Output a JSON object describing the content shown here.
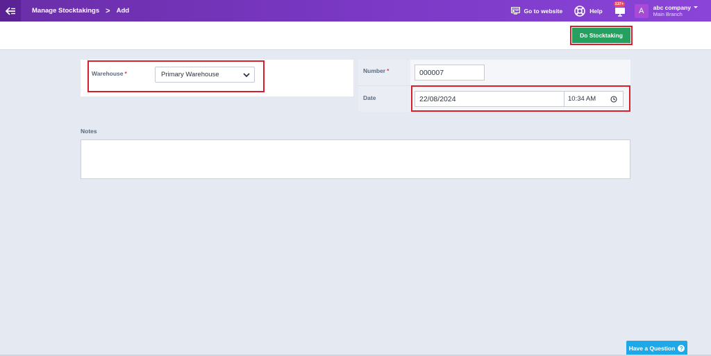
{
  "topbar": {
    "breadcrumb_parent": "Manage Stocktakings",
    "breadcrumb_sep": ">",
    "breadcrumb_current": "Add",
    "go_to_website": "Go to website",
    "help": "Help",
    "notification_count": "137+",
    "avatar_letter": "A",
    "account_name": "abc company",
    "account_branch": "Main Branch"
  },
  "actions": {
    "do_stocktaking": "Do Stocktaking"
  },
  "form": {
    "warehouse_label": "Warehouse",
    "required_mark": "*",
    "warehouse_value": "Primary Warehouse",
    "number_label": "Number",
    "number_value": "000007",
    "date_label": "Date",
    "date_value": "22/08/2024",
    "time_value": "10:34 AM",
    "notes_label": "Notes"
  },
  "help_widget": {
    "label": "Have a Question",
    "q_icon": "?"
  },
  "colors": {
    "topbar_start": "#6a2ea8",
    "topbar_end": "#8a45d8",
    "primary_action": "#25a05e",
    "highlight_outline": "#d81e2a",
    "help_button": "#1ea8e8",
    "required": "#e03545"
  }
}
